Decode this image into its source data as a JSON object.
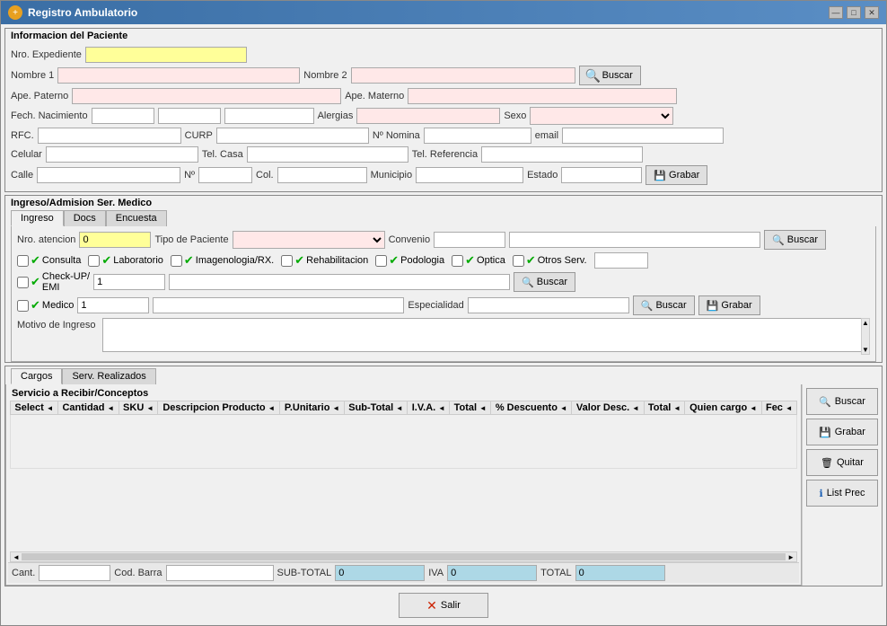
{
  "window": {
    "title": "Registro Ambulatorio",
    "icon": "R"
  },
  "patient_section": {
    "title": "Informacion del Paciente",
    "labels": {
      "nro_expediente": "Nro. Expediente",
      "nombre1": "Nombre 1",
      "nombre2": "Nombre 2",
      "ape_paterno": "Ape. Paterno",
      "ape_materno": "Ape. Materno",
      "fech_nacimiento": "Fech. Nacimiento",
      "alergias": "Alergias",
      "sexo": "Sexo",
      "rfc": "RFC.",
      "curp": "CURP",
      "nomina": "Nº Nomina",
      "email": "email",
      "celular": "Celular",
      "tel_casa": "Tel. Casa",
      "tel_referencia": "Tel. Referencia",
      "calle": "Calle",
      "no": "Nº",
      "col": "Col.",
      "municipio": "Municipio",
      "estado": "Estado"
    },
    "buttons": {
      "buscar": "Buscar",
      "grabar": "Grabar"
    }
  },
  "admission_section": {
    "title": "Ingreso/Admision Ser. Medico",
    "tabs": [
      "Ingreso",
      "Docs",
      "Encuesta"
    ],
    "active_tab": "Ingreso",
    "labels": {
      "nro_atencion": "Nro. atencion",
      "tipo_paciente": "Tipo de Paciente",
      "convenio": "Convenio"
    },
    "nro_atencion_value": "0",
    "services": [
      "Consulta",
      "Laboratorio",
      "Imagenologia/RX.",
      "Rehabilitacion",
      "Podologia",
      "Optica",
      "Otros Serv."
    ],
    "checkup_label": "Check-UP/\nEMI",
    "checkup_value": "1",
    "medico_label": "Medico",
    "medico_value": "1",
    "especialidad_label": "Especialidad",
    "motivo_label": "Motivo de Ingreso",
    "buttons": {
      "buscar_checkup": "Buscar",
      "buscar_medico": "Buscar",
      "grabar": "Grabar"
    }
  },
  "bottom_section": {
    "tabs": [
      "Cargos",
      "Serv. Realizados"
    ],
    "active_tab": "Cargos",
    "section_title": "Servicio a Recibir/Conceptos",
    "table": {
      "columns": [
        "Select",
        "Cantidad",
        "SKU",
        "Descripcion Producto",
        "P.Unitario",
        "Sub-Total",
        "I.V.A.",
        "Total",
        "% Descuento",
        "Valor Desc.",
        "Total",
        "Quien cargo",
        "Fec"
      ]
    },
    "footer": {
      "cant_label": "Cant.",
      "cod_barra_label": "Cod. Barra",
      "sub_total_label": "SUB-TOTAL",
      "sub_total_value": "0",
      "iva_label": "IVA",
      "iva_value": "0",
      "total_label": "TOTAL",
      "total_value": "0"
    },
    "buttons": {
      "buscar": "Buscar",
      "grabar": "Grabar",
      "quitar": "Quitar",
      "list_prec": "List Prec"
    }
  },
  "bottom_bar": {
    "salir": "Salir"
  }
}
